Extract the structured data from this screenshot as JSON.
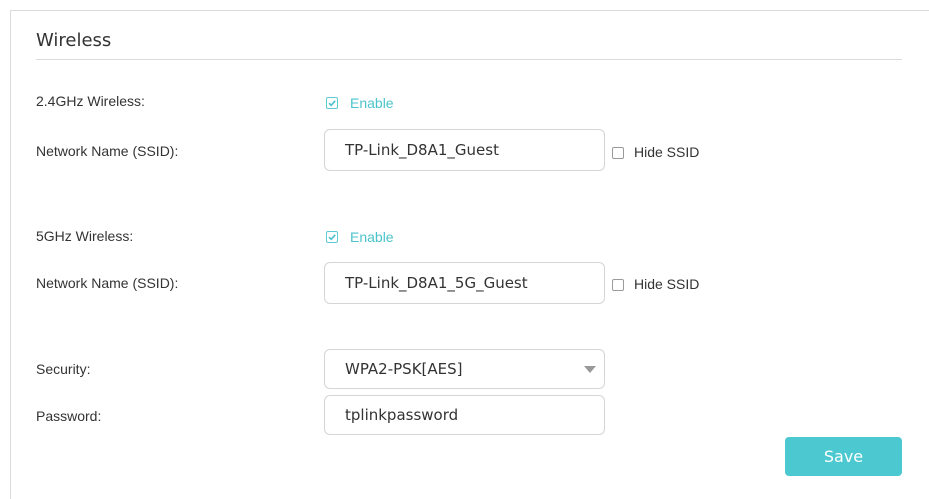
{
  "section": {
    "title": "Wireless"
  },
  "band24": {
    "label": "2.4GHz Wireless:",
    "enabled": true,
    "enable_label": "Enable",
    "ssid_label": "Network Name (SSID):",
    "ssid_value": "TP-Link_D8A1_Guest",
    "hide_ssid_label": "Hide SSID",
    "hide_ssid": false
  },
  "band5": {
    "label": "5GHz Wireless:",
    "enabled": true,
    "enable_label": "Enable",
    "ssid_label": "Network Name (SSID):",
    "ssid_value": "TP-Link_D8A1_5G_Guest",
    "hide_ssid_label": "Hide SSID",
    "hide_ssid": false
  },
  "security": {
    "label": "Security:",
    "selected": "WPA2-PSK[AES]"
  },
  "password": {
    "label": "Password:",
    "value": "tplinkpassword"
  },
  "actions": {
    "save_label": "Save"
  },
  "colors": {
    "accent": "#4cc8d0",
    "text": "#333333",
    "border": "#d5d5d5"
  },
  "icons": {
    "checkmark": "check-icon",
    "dropdown": "chevron-down-icon"
  }
}
